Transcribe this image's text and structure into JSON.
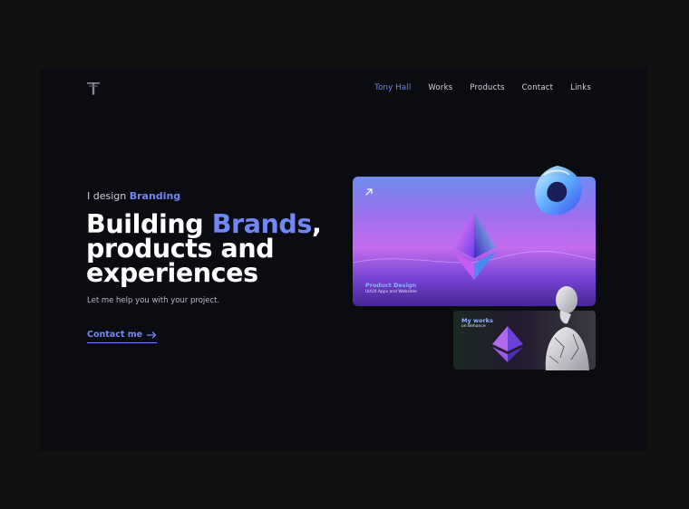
{
  "brand": {
    "logo_icon": "t-logo-icon"
  },
  "nav": {
    "items": [
      {
        "label": "Tony Hall",
        "active": true
      },
      {
        "label": "Works",
        "active": false
      },
      {
        "label": "Products",
        "active": false
      },
      {
        "label": "Contact",
        "active": false
      },
      {
        "label": "Links",
        "active": false
      }
    ]
  },
  "hero": {
    "eyebrow_prefix": "I design",
    "eyebrow_highlight": "Branding",
    "headline_part1": "Building ",
    "headline_highlight": "Brands",
    "headline_part2": ",",
    "headline_line2": "products and",
    "headline_line3": "experiences",
    "subtitle": "Let me help you with your project.",
    "cta_label": "Contact me",
    "cta_icon": "arrow-right-icon"
  },
  "cards": {
    "main": {
      "title": "Product Design",
      "subtitle": "UI/UX Apps and Websites",
      "icon": "arrow-up-right-icon"
    },
    "small": {
      "title": "My works",
      "subtitle": "on Behance"
    }
  },
  "colors": {
    "accent": "#7088f6",
    "background": "#0b0b12",
    "outer_background": "#111111",
    "text": "#ffffff"
  }
}
